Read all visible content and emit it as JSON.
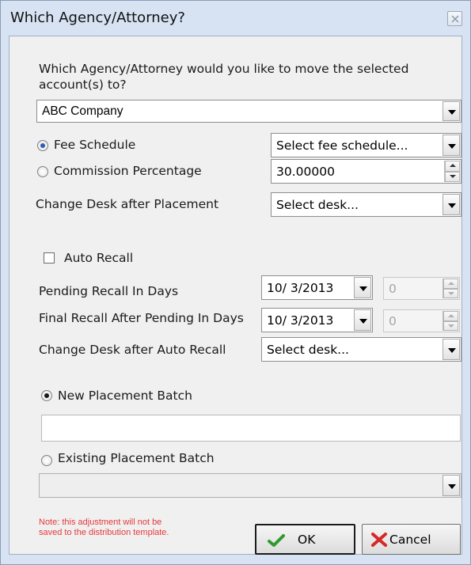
{
  "window": {
    "title": "Which Agency/Attorney?"
  },
  "prompt": {
    "line1": "Which Agency/Attorney would you like to move the selected",
    "line2": "account(s) to?"
  },
  "agency_select": {
    "value": "ABC Company"
  },
  "fee_schedule": {
    "label": "Fee Schedule",
    "selected": true,
    "value": "Select fee schedule..."
  },
  "commission": {
    "label": "Commission Percentage",
    "selected": false,
    "value": "30.00000"
  },
  "change_desk_after_placement": {
    "label": "Change Desk after Placement",
    "value": "Select desk..."
  },
  "auto_recall": {
    "label": "Auto Recall",
    "checked": false
  },
  "pending_recall": {
    "label": "Pending Recall In Days",
    "date": "10/  3/2013",
    "days": "0"
  },
  "final_recall": {
    "label": "Final Recall After Pending In Days",
    "date": "10/  3/2013",
    "days": "0"
  },
  "change_desk_after_recall": {
    "label": "Change Desk after Auto Recall",
    "value": "Select desk..."
  },
  "new_batch": {
    "label": "New Placement Batch",
    "selected": true,
    "value": ""
  },
  "existing_batch": {
    "label": "Existing Placement Batch",
    "selected": false,
    "value": ""
  },
  "note": {
    "line1": "Note: this adjustment will not be",
    "line2": "saved to the distribution template."
  },
  "buttons": {
    "ok": "OK",
    "cancel": "Cancel"
  },
  "colors": {
    "window_frame": "#d7e3f3",
    "client": "#f0f0f0",
    "note_text": "#e5393a",
    "radio_dot": "#2b5fb5"
  },
  "icons": {
    "close": "close-icon",
    "ok": "checkmark-icon",
    "cancel": "red-x-icon"
  }
}
